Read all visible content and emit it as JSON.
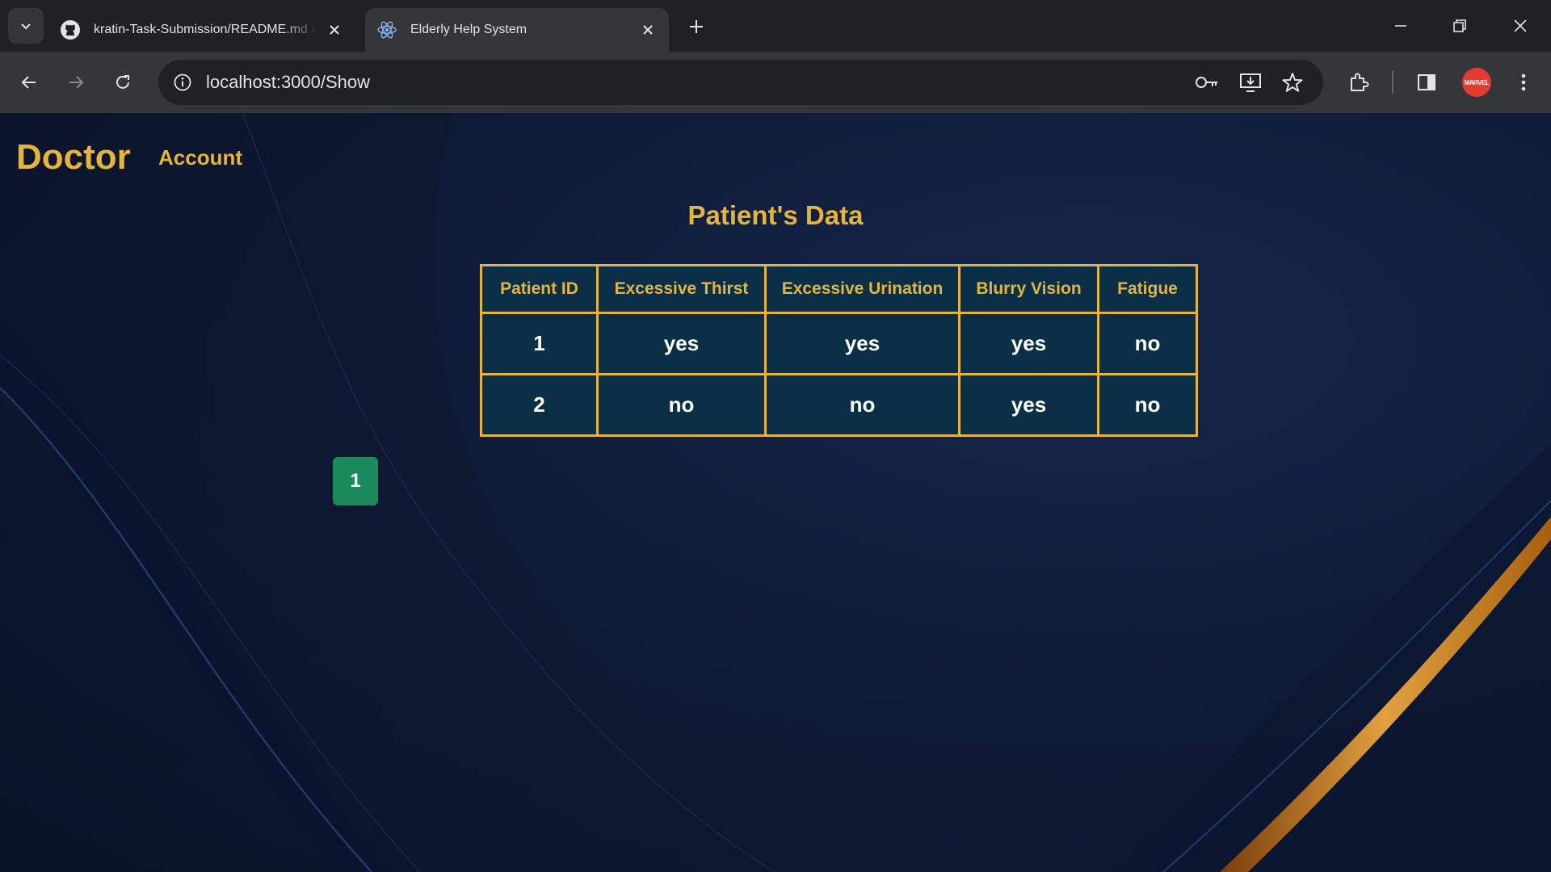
{
  "browser": {
    "tabs": [
      {
        "title": "kratin-Task-Submission/README.md at m",
        "icon": "github-icon",
        "active": false
      },
      {
        "title": "Elderly Help System",
        "icon": "react-icon",
        "active": true
      }
    ],
    "url": "localhost:3000/Show",
    "avatar_text": "MARVEL"
  },
  "navbar": {
    "brand": "Doctor",
    "links": [
      "Account"
    ]
  },
  "page": {
    "title": "Patient's Data"
  },
  "table": {
    "headers": [
      "Patient ID",
      "Excessive Thirst",
      "Excessive Urination",
      "Blurry Vision",
      "Fatigue"
    ],
    "rows": [
      [
        "1",
        "yes",
        "yes",
        "yes",
        "no"
      ],
      [
        "2",
        "no",
        "no",
        "yes",
        "no"
      ]
    ]
  },
  "pagination": {
    "current_page": "1"
  },
  "colors": {
    "accent": "#e4b43e",
    "table_bg": "#0b2f46",
    "page_button": "#1a8a5a",
    "background": "#0f1c38"
  }
}
